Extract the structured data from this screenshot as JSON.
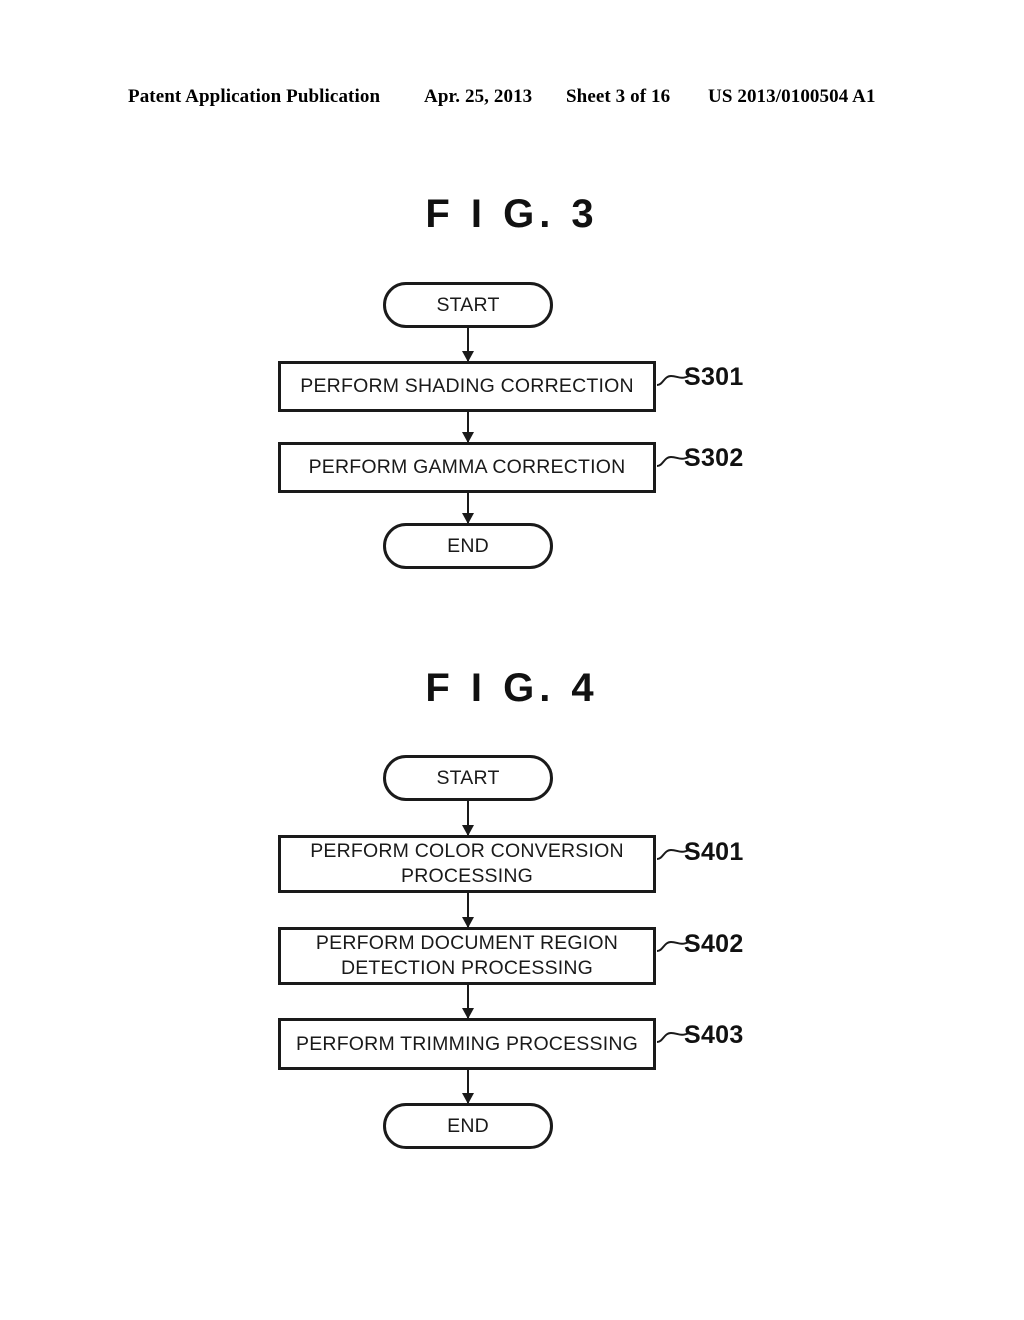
{
  "header": {
    "publication": "Patent Application Publication",
    "date": "Apr. 25, 2013",
    "sheet": "Sheet 3 of 16",
    "publication_number": "US 2013/0100504 A1"
  },
  "figures": [
    {
      "title": "F I G.  3",
      "nodes": [
        {
          "id": "fig3-start",
          "label": "START",
          "shape": "terminator"
        },
        {
          "id": "fig3-s301",
          "label": "PERFORM SHADING CORRECTION",
          "shape": "process",
          "step": "S301"
        },
        {
          "id": "fig3-s302",
          "label": "PERFORM GAMMA CORRECTION",
          "shape": "process",
          "step": "S302"
        },
        {
          "id": "fig3-end",
          "label": "END",
          "shape": "terminator"
        }
      ]
    },
    {
      "title": "F I G.  4",
      "nodes": [
        {
          "id": "fig4-start",
          "label": "START",
          "shape": "terminator"
        },
        {
          "id": "fig4-s401",
          "label": "PERFORM COLOR CONVERSION PROCESSING",
          "shape": "process",
          "step": "S401"
        },
        {
          "id": "fig4-s402",
          "label": "PERFORM DOCUMENT REGION DETECTION PROCESSING",
          "shape": "process",
          "step": "S402"
        },
        {
          "id": "fig4-s403",
          "label": "PERFORM TRIMMING PROCESSING",
          "shape": "process",
          "step": "S403"
        },
        {
          "id": "fig4-end",
          "label": "END",
          "shape": "terminator"
        }
      ]
    }
  ],
  "colors": {
    "ink": "#1a1a1a",
    "paper": "#ffffff"
  }
}
